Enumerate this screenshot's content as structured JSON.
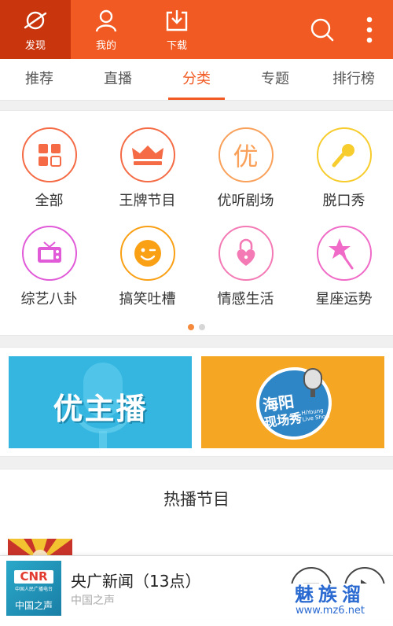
{
  "topnav": [
    {
      "label": "发现",
      "icon": "planet-icon",
      "active": true
    },
    {
      "label": "我的",
      "icon": "user-icon",
      "active": false
    },
    {
      "label": "下载",
      "icon": "download-icon",
      "active": false
    }
  ],
  "tabs": [
    "推荐",
    "直播",
    "分类",
    "专题",
    "排行榜"
  ],
  "active_tab": "分类",
  "categories": [
    {
      "label": "全部",
      "icon": "grid-icon",
      "color": "#f46b45"
    },
    {
      "label": "王牌节目",
      "icon": "crown-icon",
      "color": "#f46b45"
    },
    {
      "label": "优听剧场",
      "icon": "you-character-icon",
      "color": "#f9a15a"
    },
    {
      "label": "脱口秀",
      "icon": "microphone-icon",
      "color": "#f7cc2d"
    },
    {
      "label": "综艺八卦",
      "icon": "tv-icon",
      "color": "#e15ad8"
    },
    {
      "label": "搞笑吐槽",
      "icon": "smiley-icon",
      "color": "#f9a015"
    },
    {
      "label": "情感生活",
      "icon": "heart-lock-icon",
      "color": "#f37ab5"
    },
    {
      "label": "星座运势",
      "icon": "star-wand-icon",
      "color": "#f06bc7"
    }
  ],
  "pager": {
    "pages": 2,
    "current": 1
  },
  "banners": [
    {
      "text": "优主播",
      "bg": "#34b6e0"
    },
    {
      "line1": "海阳",
      "line2": "现场秀",
      "sub": "HiYoung Live Show",
      "bg": "#f5a623"
    }
  ],
  "hot_section": {
    "title": "热播节目"
  },
  "player": {
    "title": "央广新闻（13点）",
    "subtitle": "中国之声",
    "logo_text": "CNR",
    "logo_small": "中国人民广播电台",
    "logo_name": "中国之声"
  },
  "watermark": {
    "line1": "魅族溜",
    "line2": "www.mz6.net"
  },
  "colors": {
    "accent": "#f15a22",
    "accent_dark": "#c9360e"
  }
}
